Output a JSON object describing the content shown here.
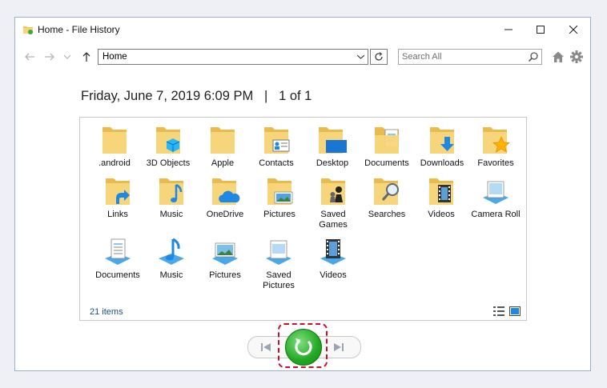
{
  "window": {
    "title": "Home - File History"
  },
  "toolbar": {
    "address_value": "Home",
    "search_placeholder": "Search All"
  },
  "header": {
    "date": "Friday, June 7, 2019 6:09 PM",
    "separator": "|",
    "page_info": "1 of 1"
  },
  "items": [
    {
      "label": ".android",
      "icon": "folder-icon"
    },
    {
      "label": "3D Objects",
      "icon": "3d-objects-folder-icon"
    },
    {
      "label": "Apple",
      "icon": "folder-icon"
    },
    {
      "label": "Contacts",
      "icon": "contacts-folder-icon"
    },
    {
      "label": "Desktop",
      "icon": "desktop-folder-icon"
    },
    {
      "label": "Documents",
      "icon": "documents-folder-icon"
    },
    {
      "label": "Downloads",
      "icon": "downloads-folder-icon"
    },
    {
      "label": "Favorites",
      "icon": "favorites-folder-icon"
    },
    {
      "label": "Links",
      "icon": "links-folder-icon"
    },
    {
      "label": "Music",
      "icon": "music-folder-icon"
    },
    {
      "label": "OneDrive",
      "icon": "onedrive-folder-icon"
    },
    {
      "label": "Pictures",
      "icon": "pictures-folder-icon"
    },
    {
      "label": "Saved Games",
      "icon": "saved-games-folder-icon"
    },
    {
      "label": "Searches",
      "icon": "searches-folder-icon"
    },
    {
      "label": "Videos",
      "icon": "videos-folder-icon"
    },
    {
      "label": "Camera Roll",
      "icon": "camera-roll-library-icon"
    },
    {
      "label": "Documents",
      "icon": "documents-library-icon"
    },
    {
      "label": "Music",
      "icon": "music-library-icon"
    },
    {
      "label": "Pictures",
      "icon": "pictures-library-icon"
    },
    {
      "label": "Saved Pictures",
      "icon": "saved-pictures-library-icon"
    },
    {
      "label": "Videos",
      "icon": "videos-library-icon"
    }
  ],
  "status": {
    "item_count": "21 items"
  },
  "colors": {
    "folder": "#f7d57a",
    "folder_dark": "#e9bb4e",
    "accent_blue": "#1e88e5",
    "restore_green": "#23a823",
    "highlight_red": "#c8102e"
  }
}
